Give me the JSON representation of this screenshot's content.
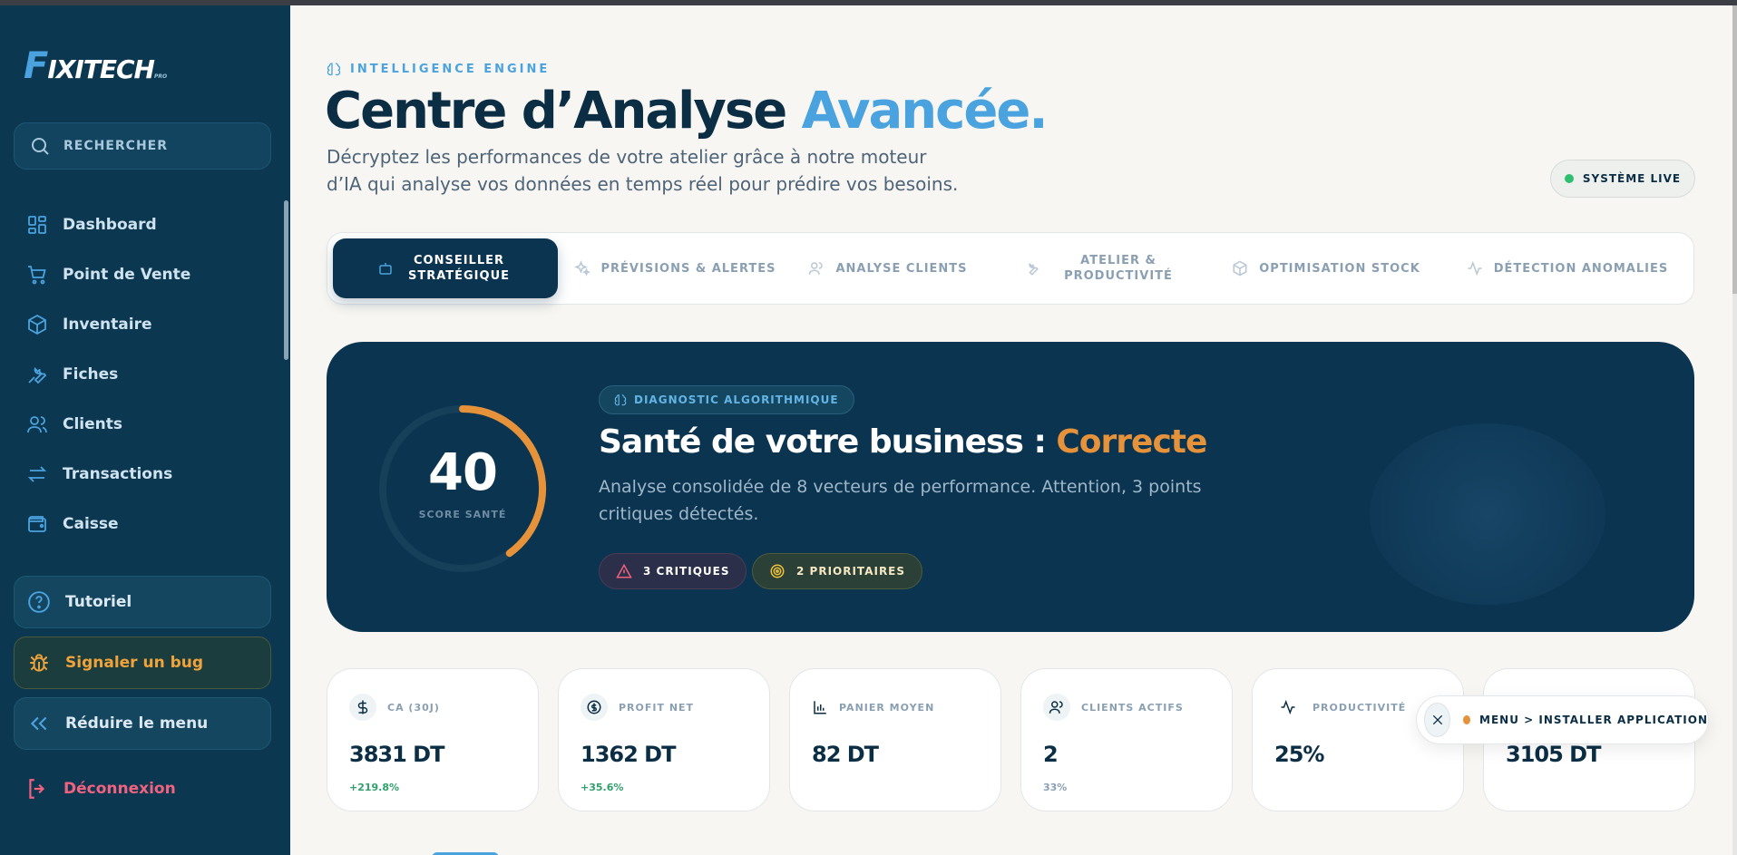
{
  "brand": {
    "logo_initial": "F",
    "logo_rest": "IXITECH",
    "logo_suffix": "PRO"
  },
  "sidebar": {
    "search_label": "RECHERCHER",
    "items": [
      {
        "label": "Dashboard",
        "icon": "dashboard-icon"
      },
      {
        "label": "Point de Vente",
        "icon": "cart-icon"
      },
      {
        "label": "Inventaire",
        "icon": "box-icon"
      },
      {
        "label": "Fiches",
        "icon": "wrench-icon"
      },
      {
        "label": "Clients",
        "icon": "users-icon"
      },
      {
        "label": "Transactions",
        "icon": "arrows-icon"
      },
      {
        "label": "Caisse",
        "icon": "wallet-icon"
      }
    ],
    "tutorial_label": "Tutoriel",
    "bug_label": "Signaler un bug",
    "collapse_label": "Réduire le menu",
    "logout_label": "Déconnexion"
  },
  "header": {
    "eyebrow": "INTELLIGENCE ENGINE",
    "title_main": "Centre d’Analyse ",
    "title_accent": "Avancée.",
    "subtitle": "Décryptez les performances de votre atelier grâce à notre moteur d’IA qui analyse vos données en temps réel pour prédire vos besoins.",
    "live_label": "SYSTÈME LIVE"
  },
  "tabs": [
    {
      "label": "CONSEILLER STRATÉGIQUE",
      "icon": "robot-icon",
      "active": true
    },
    {
      "label": "PRÉVISIONS & ALERTES",
      "icon": "sparkles-icon"
    },
    {
      "label": "ANALYSE CLIENTS",
      "icon": "users-icon"
    },
    {
      "label": "ATELIER & PRODUCTIVITÉ",
      "icon": "wrench-icon"
    },
    {
      "label": "OPTIMISATION STOCK",
      "icon": "box-icon"
    },
    {
      "label": "DÉTECTION ANOMALIES",
      "icon": "pulse-icon"
    }
  ],
  "hero": {
    "score": "40",
    "score_value": 40,
    "score_label": "SCORE SANTÉ",
    "badge": "DIAGNOSTIC ALGORITHMIQUE",
    "title_main": "Santé de votre business : ",
    "title_status": "Correcte",
    "description": "Analyse consolidée de 8 vecteurs de performance. Attention, 3 points critiques détectés.",
    "critical_label": "3 CRITIQUES",
    "priority_label": "2 PRIORITAIRES",
    "colors": {
      "bg": "#0b3450",
      "status": "#e5923a",
      "accent": "#4aa3df"
    }
  },
  "kpis": [
    {
      "label": "CA (30J)",
      "value": "3831 DT",
      "delta": "+219.8%",
      "icon": "dollar-icon"
    },
    {
      "label": "PROFIT NET",
      "value": "1362 DT",
      "delta": "+35.6%",
      "icon": "coin-icon"
    },
    {
      "label": "PANIER MOYEN",
      "value": "82 DT",
      "delta": "",
      "icon": "bar-chart-icon"
    },
    {
      "label": "CLIENTS ACTIFS",
      "value": "2",
      "delta": "33%",
      "icon": "users-icon"
    },
    {
      "label": "PRODUCTIVITÉ",
      "value": "25%",
      "delta": "",
      "icon": "pulse-icon"
    },
    {
      "label": "",
      "value": "3105 DT",
      "delta": "",
      "icon": ""
    }
  ],
  "toast": {
    "message": "MENU > INSTALLER APPLICATION"
  }
}
